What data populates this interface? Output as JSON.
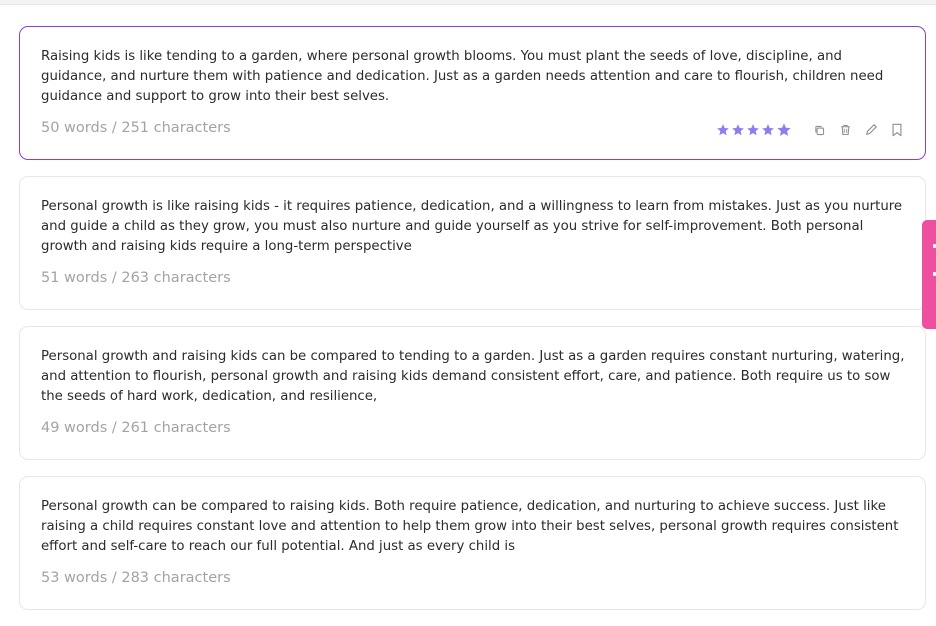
{
  "results": [
    {
      "text": "Raising kids is like tending to a garden, where personal growth blooms. You must plant the seeds of love, discipline, and guidance, and nurture them with patience and dedication. Just as a garden needs attention and care to flourish, children need guidance and support to grow into their best selves.",
      "meta": "50 words / 251 characters",
      "selected": true,
      "rating": 5
    },
    {
      "text": "Personal growth is like raising kids - it requires patience, dedication, and a willingness to learn from mistakes. Just as you nurture and guide a child as they grow, you must also nurture and guide yourself as you strive for self-improvement. Both personal growth and raising kids require a long-term perspective",
      "meta": "51 words / 263 characters"
    },
    {
      "text": "Personal growth and raising kids can be compared to tending to a garden. Just as a garden requires constant nurturing, watering, and attention to flourish, personal growth and raising kids demand consistent effort, care, and patience. Both require us to sow the seeds of hard work, dedication, and resilience,",
      "meta": "49 words / 261 characters"
    },
    {
      "text": "Personal growth can be compared to raising kids. Both require patience, dedication, and nurturing to achieve success. Just like raising a child requires constant love and attention to help them grow into their best selves, personal growth requires consistent effort and self-care to reach our full potential. And just as every child is",
      "meta": "53 words / 283 characters"
    }
  ],
  "icons": {
    "rating": "star-icon",
    "copy": "copy-icon",
    "delete": "trash-icon",
    "edit": "pencil-icon",
    "save": "bookmark-icon"
  },
  "colors": {
    "selected_border": "#8a3fd1",
    "star": "#8b7ff0",
    "side_tab": "#ee4f9f",
    "meta_text": "#a2a2a8"
  }
}
